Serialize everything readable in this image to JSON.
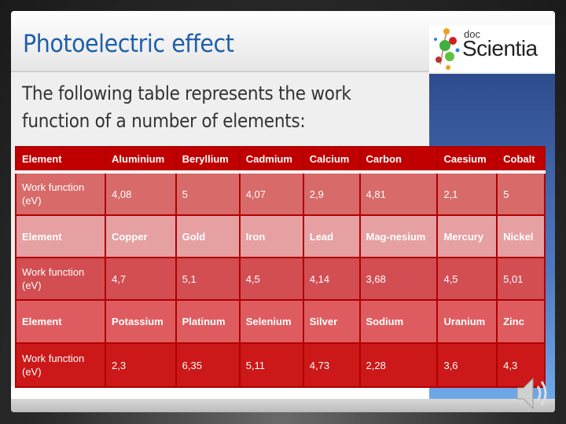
{
  "title": "Photoelectric effect",
  "logo": {
    "line1": "doc",
    "line2": "Scientia"
  },
  "intro": "The following table represents the work function of a number of elements:",
  "colors": {
    "title": "#1f5fa8",
    "header": "#c00000",
    "accent_panel": "#2e4c8c"
  },
  "table": {
    "rows": [
      [
        "Element",
        "Aluminium",
        "Beryllium",
        "Cadmium",
        "Calcium",
        "Carbon",
        "Caesium",
        "Cobalt"
      ],
      [
        "Work function (eV)",
        "4,08",
        "5",
        "4,07",
        "2,9",
        "4,81",
        "2,1",
        "5"
      ],
      [
        "Element",
        "Copper",
        "Gold",
        "Iron",
        "Lead",
        "Mag-nesium",
        "Mercury",
        "Nickel"
      ],
      [
        "Work function (eV)",
        "4,7",
        "5,1",
        "4,5",
        "4,14",
        "3,68",
        "4,5",
        "5,01"
      ],
      [
        "Element",
        "Potassium",
        "Platinum",
        "Selenium",
        "Silver",
        "Sodium",
        "Uranium",
        "Zinc"
      ],
      [
        "Work function (eV)",
        "2,3",
        "6,35",
        "5,11",
        "4,73",
        "2,28",
        "3,6",
        "4,3"
      ]
    ]
  },
  "icons": {
    "audio": "speaker-icon"
  }
}
